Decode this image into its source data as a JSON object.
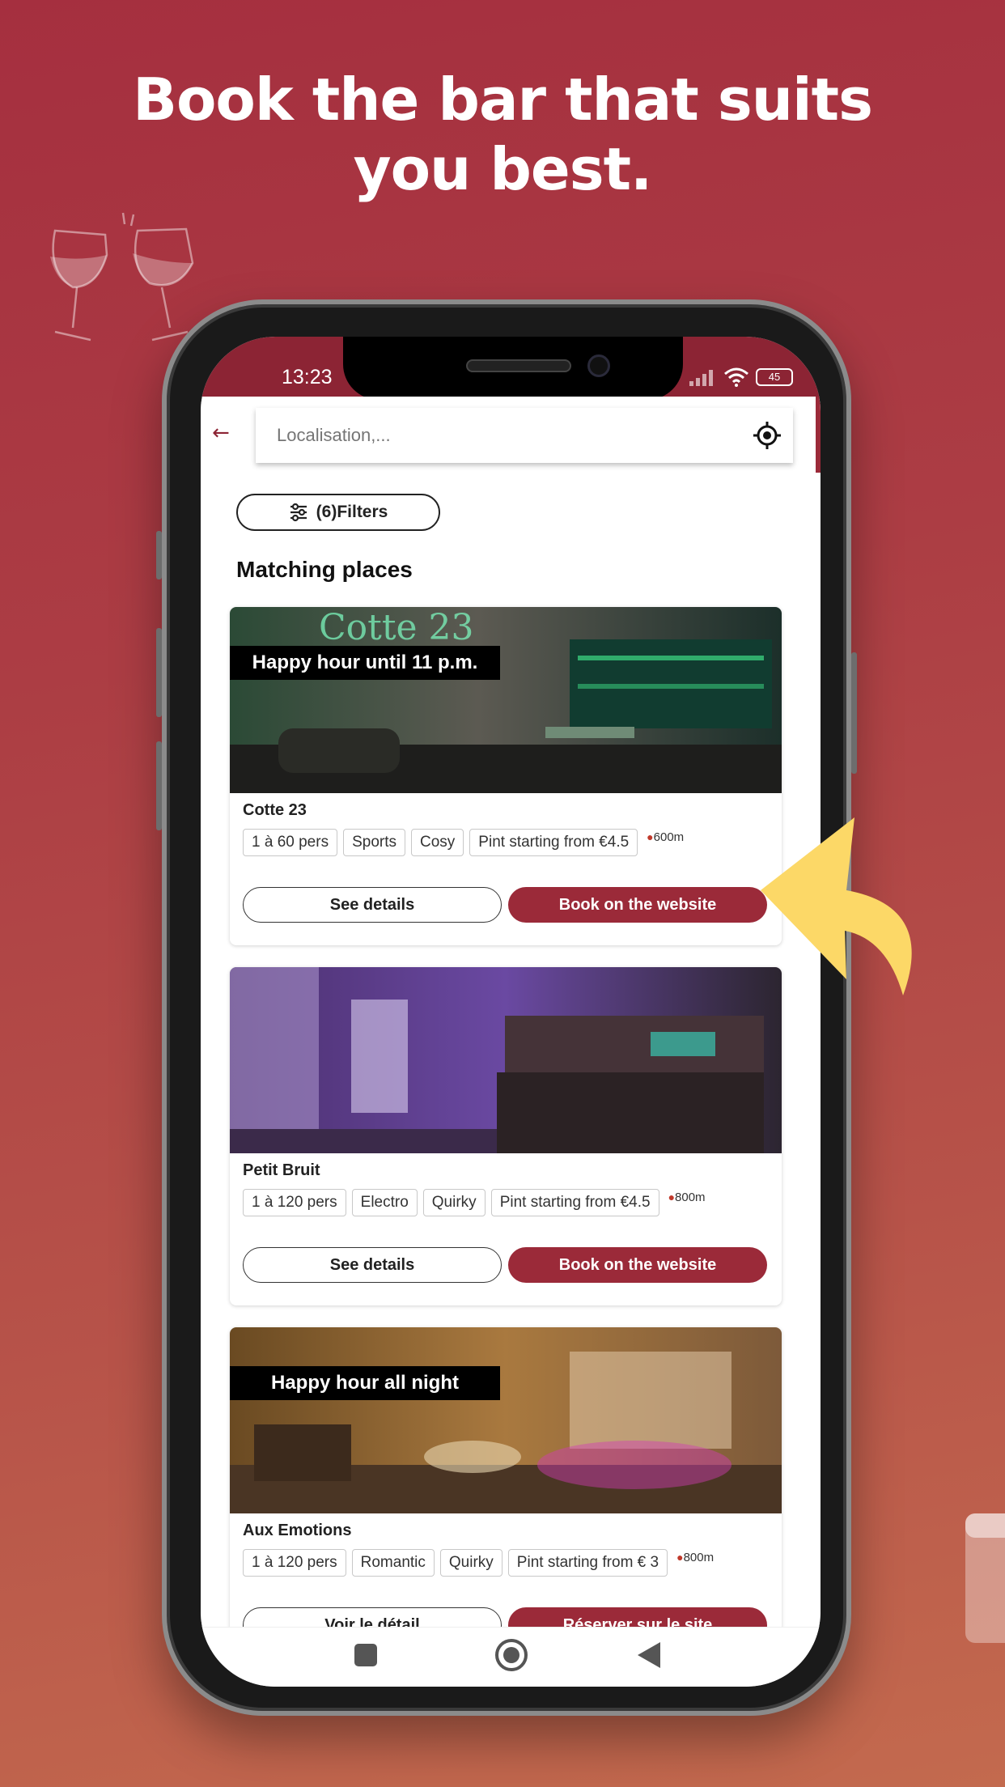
{
  "headline": {
    "line1": "Book the bar that suits",
    "line2": "you best."
  },
  "status": {
    "time": "13:23",
    "battery": "45"
  },
  "search": {
    "placeholder": "Localisation,..."
  },
  "filters_label": "(6)Filters",
  "section_title": "Matching places",
  "places": [
    {
      "name": "Cotte 23",
      "banner": "Happy hour until 11 p.m.",
      "tags": [
        "1 à 60 pers",
        "Sports",
        "Cosy",
        "Pint starting from €4.5"
      ],
      "distance": "600m",
      "details_label": "See details",
      "book_label": "Book on the website"
    },
    {
      "name": "Petit Bruit",
      "banner": "",
      "tags": [
        "1 à 120 pers",
        "Electro",
        "Quirky",
        "Pint starting from €4.5"
      ],
      "distance": "800m",
      "details_label": "See details",
      "book_label": "Book on the website"
    },
    {
      "name": "Aux Emotions",
      "banner": "Happy hour all night",
      "tags": [
        "1 à 120 pers",
        "Romantic",
        "Quirky",
        "Pint starting from € 3"
      ],
      "distance": "800m",
      "details_label": "Voir le détail",
      "book_label": "Réserver sur le site"
    }
  ],
  "colors": {
    "brand": "#9b2a39",
    "statusbar": "#8c2434",
    "arrow": "#fcd867"
  },
  "icons": {
    "back": "arrow-left-icon",
    "locate": "crosshair-icon",
    "filters": "sliders-icon",
    "pin": "location-pin-icon",
    "deco_top": "wine-glasses-icon",
    "deco_bottom": "beer-glass-icon",
    "pointer": "curved-arrow-icon"
  }
}
